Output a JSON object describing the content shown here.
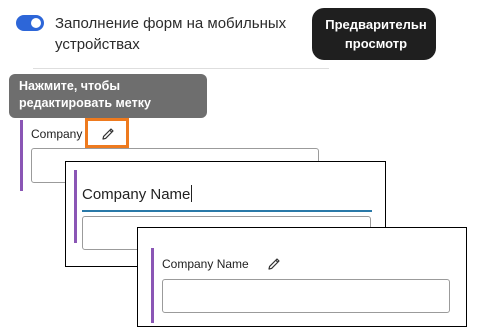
{
  "mobile_form_filling": {
    "label": "Заполнение форм на  мобильных устройствах",
    "enabled": true,
    "toggle_color": "#2d66d8"
  },
  "preview_button": {
    "label_line1": "Предварительн",
    "label_line2": "просмотр"
  },
  "tooltip": {
    "line1": "Нажмите, чтобы",
    "line2": "редактировать метку"
  },
  "field_default": {
    "label": "Company",
    "edit_icon": "pencil-icon",
    "highlight_color": "#ee7a1e",
    "accent_color": "#8a56b5"
  },
  "field_editing": {
    "label_value": "Company Name",
    "underline_color": "#2a79a8"
  },
  "field_renamed": {
    "label": "Company Name",
    "edit_icon": "pencil-icon"
  }
}
